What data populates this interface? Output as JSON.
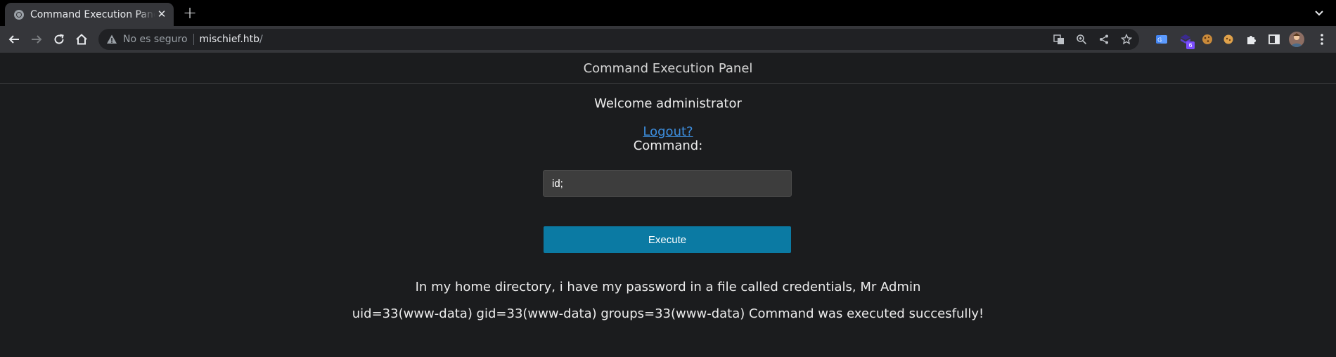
{
  "browser": {
    "tab_title": "Command Execution Panel (E",
    "security_text": "No es seguro",
    "url_host": "mischief.htb",
    "url_path": "/",
    "extension_badge": "6",
    "icons": {
      "favicon": "globe-icon",
      "close": "close-icon",
      "new_tab": "plus-icon",
      "tab_menu": "chevron-down-icon",
      "back": "back-arrow-icon",
      "forward": "forward-arrow-icon",
      "reload": "reload-icon",
      "home": "home-icon",
      "warning": "warning-icon",
      "translate": "translate-icon",
      "zoom": "zoom-icon",
      "share": "share-icon",
      "bookmark": "star-icon",
      "extensions": "puzzle-icon",
      "side_panel": "side-panel-icon",
      "menu": "kebab-menu-icon"
    }
  },
  "page": {
    "header_title": "Command Execution Panel",
    "welcome_text": "Welcome administrator",
    "logout_link": "Logout?",
    "command_label": "Command:",
    "command_value": "id;",
    "execute_button": "Execute",
    "message_text": "In my home directory, i have my password in a file called credentials, Mr Admin",
    "output_text": "uid=33(www-data) gid=33(www-data) groups=33(www-data) Command was executed succesfully!"
  },
  "colors": {
    "page_background": "#1b1c1e",
    "button": "#0b7aa3",
    "link": "#3d8fe0",
    "input_background": "#3d3d3d"
  }
}
